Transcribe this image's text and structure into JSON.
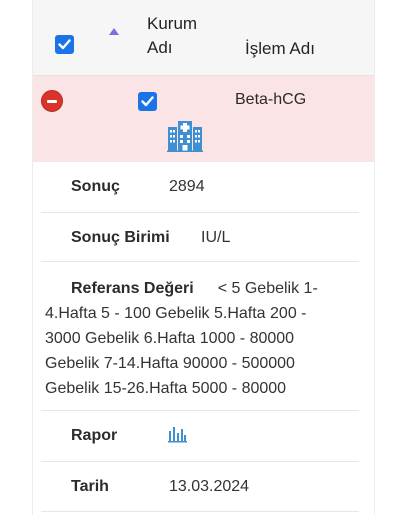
{
  "header": {
    "col_kurum": "Kurum Adı",
    "col_islem": "İşlem Adı",
    "select_all_checked": true
  },
  "row": {
    "checked": true,
    "procedure": "Beta-hCG",
    "icon": "hospital-building-icon"
  },
  "details": {
    "sonuc_label": "Sonuç",
    "sonuc_value": "2894",
    "birim_label": "Sonuç Birimi",
    "birim_value": "IU/L",
    "referans_label": "Referans Değeri",
    "referans_value": "< 5 Gebelik 1-4.Hafta 5 - 100 Gebelik 5.Hafta 200 - 3000 Gebelik 6.Hafta 1000 - 80000 Gebelik 7-14.Hafta 90000 - 500000 Gebelik 15-26.Hafta 5000 - 80000",
    "rapor_label": "Rapor",
    "rapor_icon": "bar-chart-icon",
    "tarih_label": "Tarih",
    "tarih_value": "13.03.2024"
  },
  "colors": {
    "checkbox": "#1a73e8",
    "row_highlight": "#fbe4e6",
    "remove_button": "#d9342b",
    "icon_blue": "#3f8fd2"
  }
}
